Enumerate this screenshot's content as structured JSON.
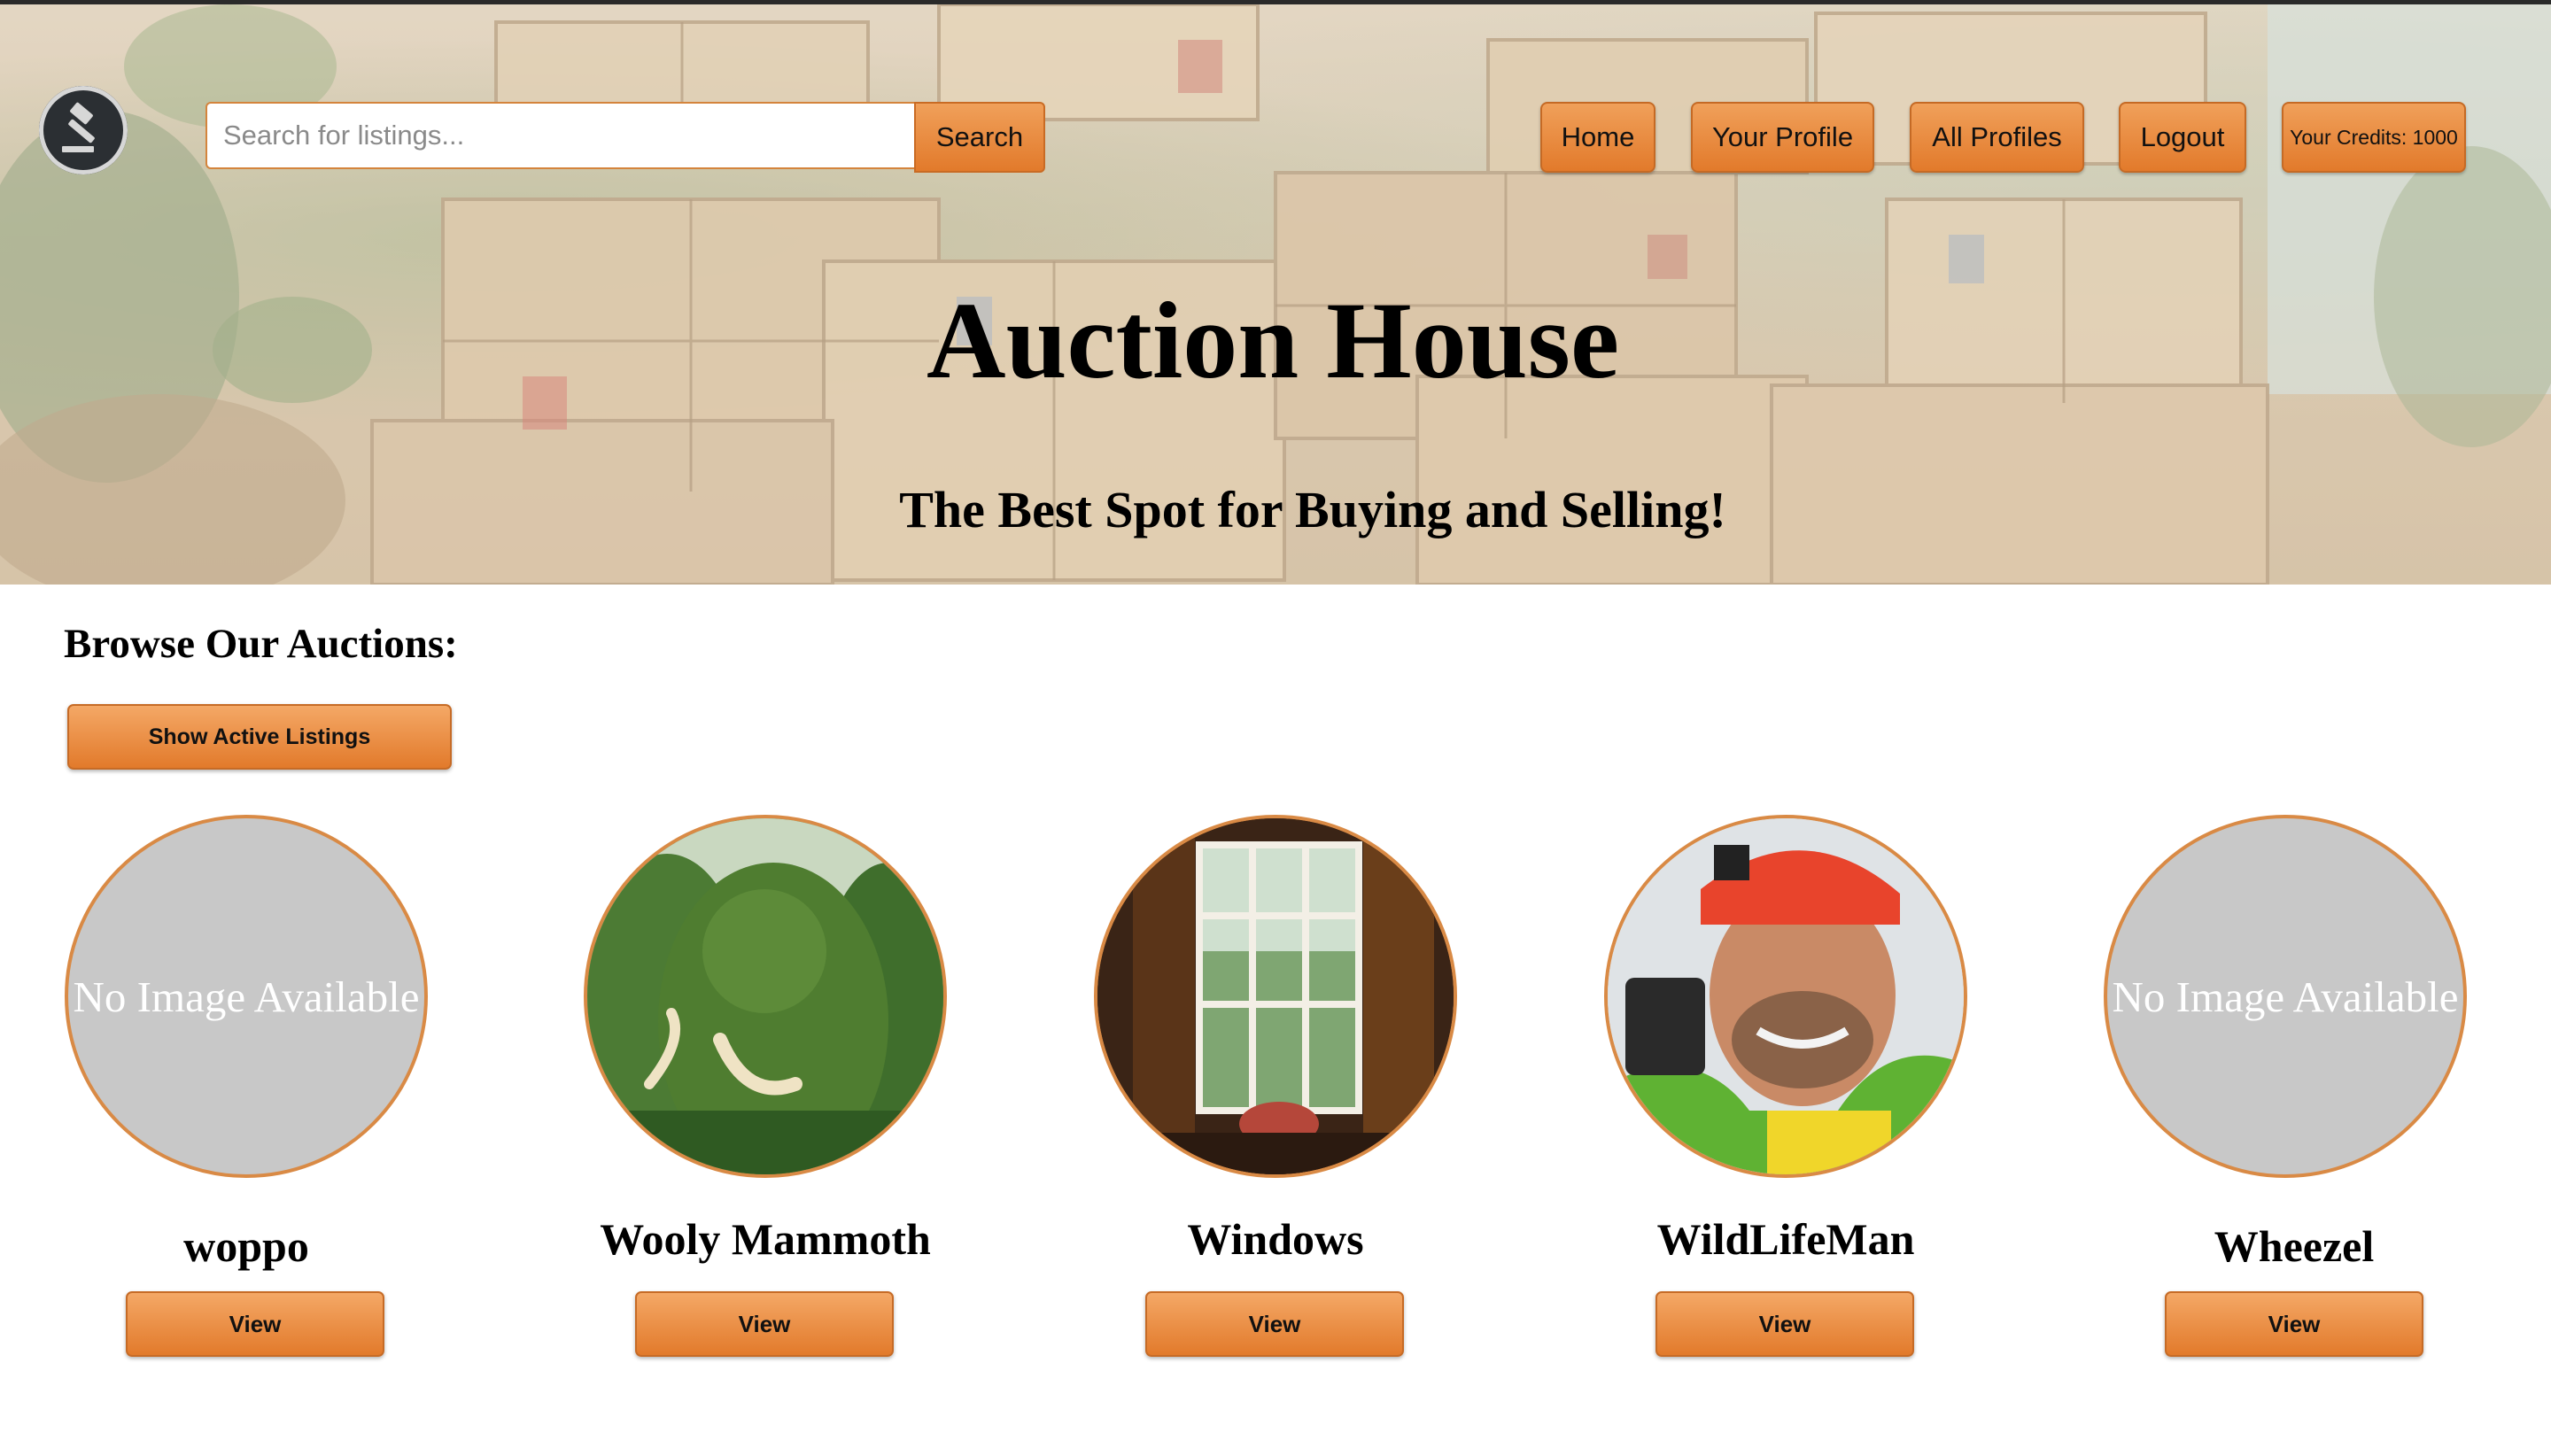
{
  "header": {
    "search_placeholder": "Search for listings...",
    "search_button": "Search",
    "nav": [
      "Home",
      "Your Profile",
      "All Profiles",
      "Logout"
    ],
    "credits": "Your Credits: 1000"
  },
  "hero": {
    "title": "Auction House",
    "subtitle": "The Best Spot for Buying and Selling!"
  },
  "browse": {
    "heading": "Browse Our Auctions:",
    "toggle_button": "Show Active Listings"
  },
  "profiles": [
    {
      "name": "woppo",
      "image": "none",
      "no_image_text": "No Image Available",
      "button": "View"
    },
    {
      "name": "Wooly Mammoth",
      "image": "moss-mammoth-photo",
      "button": "View"
    },
    {
      "name": "Windows",
      "image": "window-interior-photo",
      "button": "View"
    },
    {
      "name": "WildLifeMan",
      "image": "man-red-hat-photo",
      "button": "View"
    },
    {
      "name": "Wheezel",
      "image": "none",
      "no_image_text": "No Image Available",
      "button": "View"
    }
  ],
  "colors": {
    "button_orange": "#e27a2b",
    "avatar_border": "#d98a45",
    "placeholder_gray": "#c8c8c8"
  }
}
